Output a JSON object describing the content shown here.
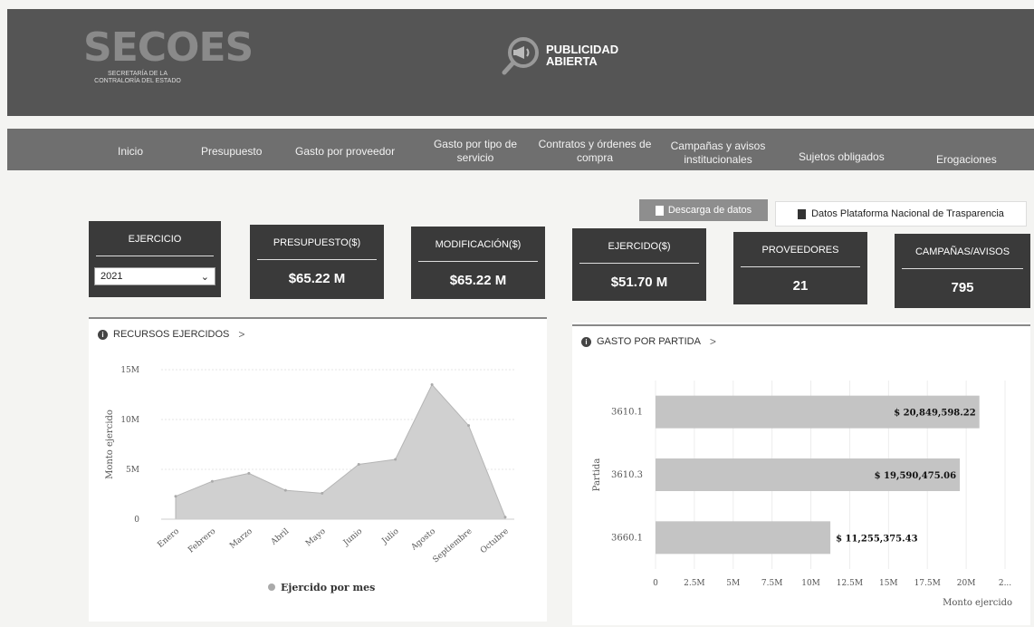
{
  "header": {
    "logo_text": "SECOES",
    "logo_subtitle_line1": "SECRETARÍA DE LA",
    "logo_subtitle_line2": "CONTRALORÍA DEL ESTADO",
    "brand_line1": "PUBLICIDAD",
    "brand_line2": "ABIERTA",
    "colors": {
      "header_bg": "#555555",
      "nav_bg": "#6f6f6f",
      "card_bg": "#3a3a3a"
    }
  },
  "nav": {
    "items": [
      {
        "line1": "Inicio",
        "line2": ""
      },
      {
        "line1": "Presupuesto",
        "line2": ""
      },
      {
        "line1": "Gasto por proveedor",
        "line2": ""
      },
      {
        "line1": "Gasto por tipo de",
        "line2": "servicio"
      },
      {
        "line1": "Contratos y órdenes de",
        "line2": "compra"
      },
      {
        "line1": "Campañas y avisos",
        "line2": "institucionales"
      },
      {
        "line1": "Sujetos obligados",
        "line2": ""
      },
      {
        "line1": "Erogaciones",
        "line2": ""
      }
    ]
  },
  "actions": {
    "download_label": "Descarga de datos",
    "pnt_label": "Datos Plataforma Nacional de Trasparencia"
  },
  "cards": {
    "ejercicio": {
      "label": "EJERCICIO",
      "selected": "2021"
    },
    "presupuesto": {
      "label": "PRESUPUESTO($)",
      "value": "$65.22 M"
    },
    "modificacion": {
      "label": "MODIFICACIÓN($)",
      "value": "$65.22 M"
    },
    "ejercido": {
      "label": "EJERCIDO($)",
      "value": "$51.70 M"
    },
    "proveedores": {
      "label": "PROVEEDORES",
      "value": "21"
    },
    "campanas": {
      "label": "CAMPAÑAS/AVISOS",
      "value": "795"
    }
  },
  "panels": {
    "recursos_title": "RECURSOS EJERCIDOS",
    "gasto_title": "GASTO POR PARTIDA",
    "chevron": ">"
  },
  "chart_data": [
    {
      "type": "area",
      "title": "",
      "ylabel": "Monto ejercido",
      "xlabel": "",
      "x": [
        "Enero",
        "Febrero",
        "Marzo",
        "Abril",
        "Mayo",
        "Junio",
        "Julio",
        "Agosto",
        "Septiembre",
        "Octubre"
      ],
      "series": [
        {
          "name": "Ejercido por mes",
          "values": [
            2.3,
            3.8,
            4.6,
            2.9,
            2.6,
            5.5,
            6.0,
            13.5,
            9.4,
            0.2
          ]
        }
      ],
      "y_unit": "M",
      "ylim": [
        0,
        15
      ],
      "yticks": [
        "0",
        "5M",
        "10M",
        "15M"
      ],
      "grid": true,
      "legend": "bottom",
      "color": "#d0d0d0"
    },
    {
      "type": "bar",
      "orientation": "horizontal",
      "title": "",
      "ylabel": "Partida",
      "xlabel": "Monto ejercido",
      "categories": [
        "3610.1",
        "3610.3",
        "3660.1"
      ],
      "values": [
        20849598.22,
        19590475.06,
        11255375.43
      ],
      "value_labels": [
        "$ 20,849,598.22",
        "$ 19,590,475.06",
        "$ 11,255,375.43"
      ],
      "xlim": [
        0,
        22500000
      ],
      "xticks": [
        "0",
        "2.5M",
        "5M",
        "7.5M",
        "10M",
        "12.5M",
        "15M",
        "17.5M",
        "20M",
        "2..."
      ],
      "grid": true,
      "color": "#c4c4c4"
    }
  ]
}
